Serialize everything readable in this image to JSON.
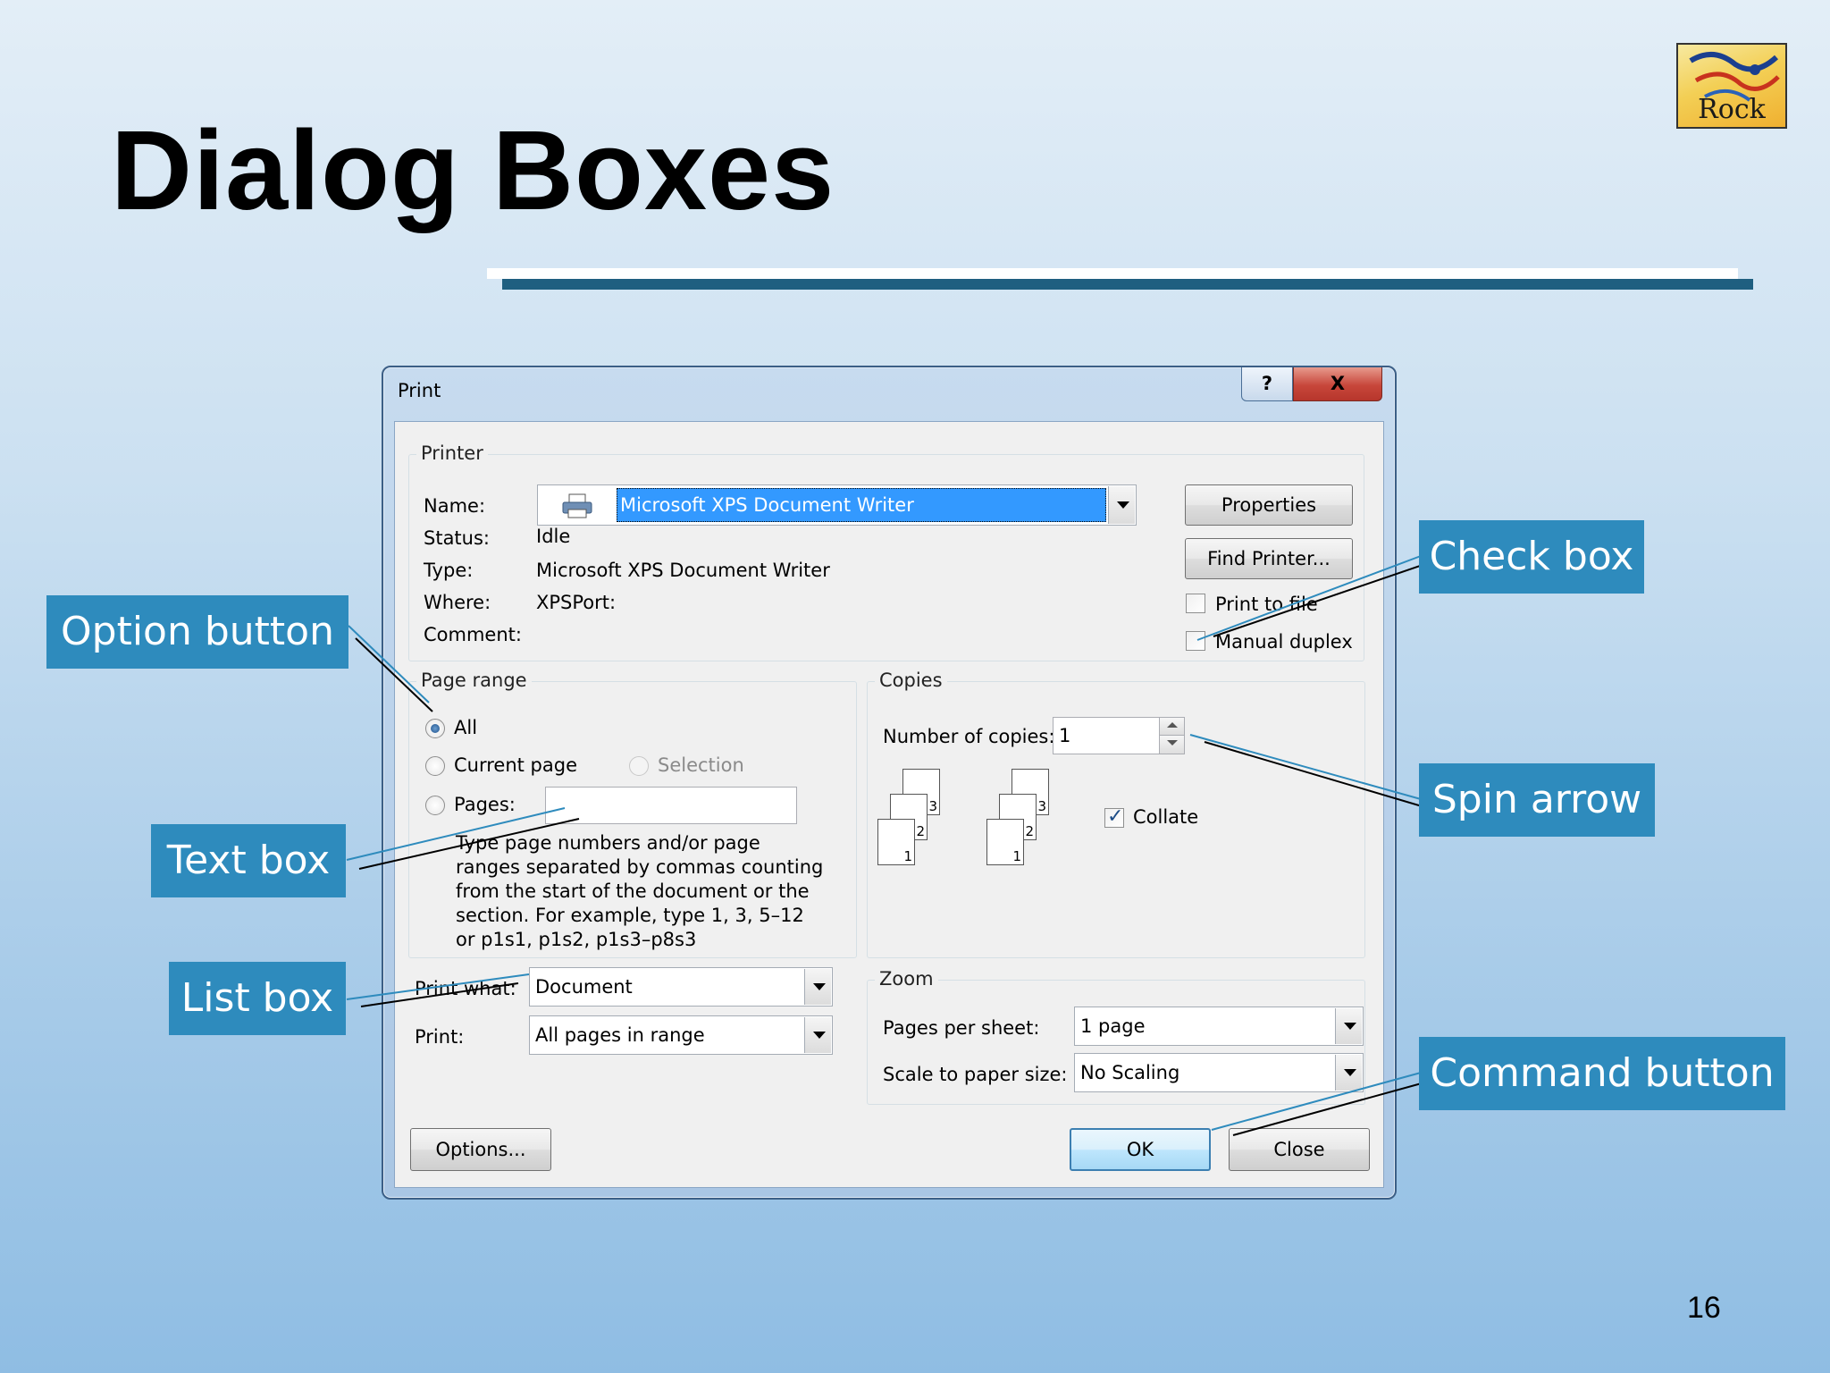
{
  "slide": {
    "title": "Dialog Boxes",
    "page_number": "16",
    "logo_text": "Rock"
  },
  "dialog": {
    "title": "Print",
    "help_label": "?",
    "close_label": "X",
    "printer": {
      "group_label": "Printer",
      "name_label": "Name:",
      "name_value": "Microsoft XPS Document Writer",
      "status_label": "Status:",
      "status_value": "Idle",
      "type_label": "Type:",
      "type_value": "Microsoft XPS Document Writer",
      "where_label": "Where:",
      "where_value": "XPSPort:",
      "comment_label": "Comment:",
      "properties_button": "Properties",
      "find_printer_button": "Find Printer...",
      "print_to_file_label": "Print to file",
      "print_to_file_checked": false,
      "manual_duplex_label": "Manual duplex",
      "manual_duplex_checked": false
    },
    "page_range": {
      "group_label": "Page range",
      "all_label": "All",
      "current_page_label": "Current page",
      "selection_label": "Selection",
      "pages_label": "Pages:",
      "pages_value": "",
      "selected_option": "All",
      "help_lines": [
        "Type page numbers and/or page",
        "ranges separated by commas counting",
        "from the start of the document or the",
        "section. For example, type 1, 3, 5–12",
        "or p1s1, p1s2, p1s3–p8s3"
      ]
    },
    "copies": {
      "group_label": "Copies",
      "number_label": "Number of copies:",
      "number_value": "1",
      "collate_label": "Collate",
      "collate_checked": true,
      "collate_pages": [
        "1",
        "2",
        "3"
      ]
    },
    "print_what": {
      "label": "Print what:",
      "value": "Document"
    },
    "print": {
      "label": "Print:",
      "value": "All pages in range"
    },
    "zoom": {
      "group_label": "Zoom",
      "pages_per_sheet_label": "Pages per sheet:",
      "pages_per_sheet_value": "1 page",
      "scale_label": "Scale to paper size:",
      "scale_value": "No Scaling"
    },
    "options_button": "Options...",
    "ok_button": "OK",
    "close_button": "Close"
  },
  "callouts": {
    "option_button": "Option button",
    "text_box": "Text box",
    "list_box": "List box",
    "check_box": "Check box",
    "spin_arrow": "Spin arrow",
    "command_button": "Command button"
  },
  "colors": {
    "callout_fill": "#2e8bbd",
    "selection_highlight": "#3399ff",
    "title_rule": "#1f5f80"
  }
}
